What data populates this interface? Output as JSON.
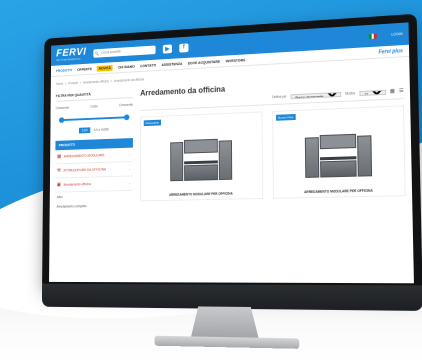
{
  "header": {
    "logo": "FERVI",
    "tagline": "the Smart Equipment",
    "search_placeholder": "Cerca prodotti",
    "youtube_icon": "youtube-icon",
    "facebook_icon": "facebook-icon",
    "flag_colors": [
      "#009246",
      "#ffffff",
      "#ce2b37"
    ],
    "account_label": "LOGIN"
  },
  "nav": {
    "items": [
      {
        "label": "PRODOTTI"
      },
      {
        "label": "OFFERTE"
      },
      {
        "label": "NOVITÀ"
      },
      {
        "label": "CHI SIAMO"
      },
      {
        "label": "CONTATTI"
      },
      {
        "label": "ASSISTENZA"
      },
      {
        "label": "DOVE ACQUISTARE"
      },
      {
        "label": "INVESTORS"
      }
    ],
    "brand": "Fervi plus"
  },
  "breadcrumb": [
    "Home",
    ">",
    "Prodotti",
    ">",
    "Arredamento officina",
    ">",
    "Arredamento da officina"
  ],
  "sidebar": {
    "filter_title": "FILTRA PER QUANTITÀ",
    "price_labels": [
      "Crescente",
      "Costo",
      "Crescente"
    ],
    "range_from": "0,00",
    "range_to": "4.0 x 0,000",
    "section_header": "PRODOTTI",
    "items": [
      {
        "label": "ARREDAMENTO MODULARE",
        "icon": "cabinet-icon"
      },
      {
        "label": "ATTREZZATURE DA OFFICINA",
        "icon": "tools-icon"
      },
      {
        "label": "Arredamento officina",
        "icon": "cart-icon"
      }
    ],
    "plain_items": [
      "Altro",
      "Arredamento completo"
    ]
  },
  "main": {
    "title": "Arredamento da officina",
    "order_label": "Ordina per",
    "order_value": "Prezzo decrescente",
    "show_label": "Mostra",
    "show_value": "12",
    "products": [
      {
        "badge": "Disponibile",
        "name": "ARREDAMENTO MODULARE PER OFFICINA"
      },
      {
        "badge": "Nuovo Disp.",
        "name": "ARREDAMENTO MODULARE PER OFFICINA"
      }
    ]
  },
  "colors": {
    "accent": "#1e87d8",
    "highlight": "#f5c400"
  }
}
